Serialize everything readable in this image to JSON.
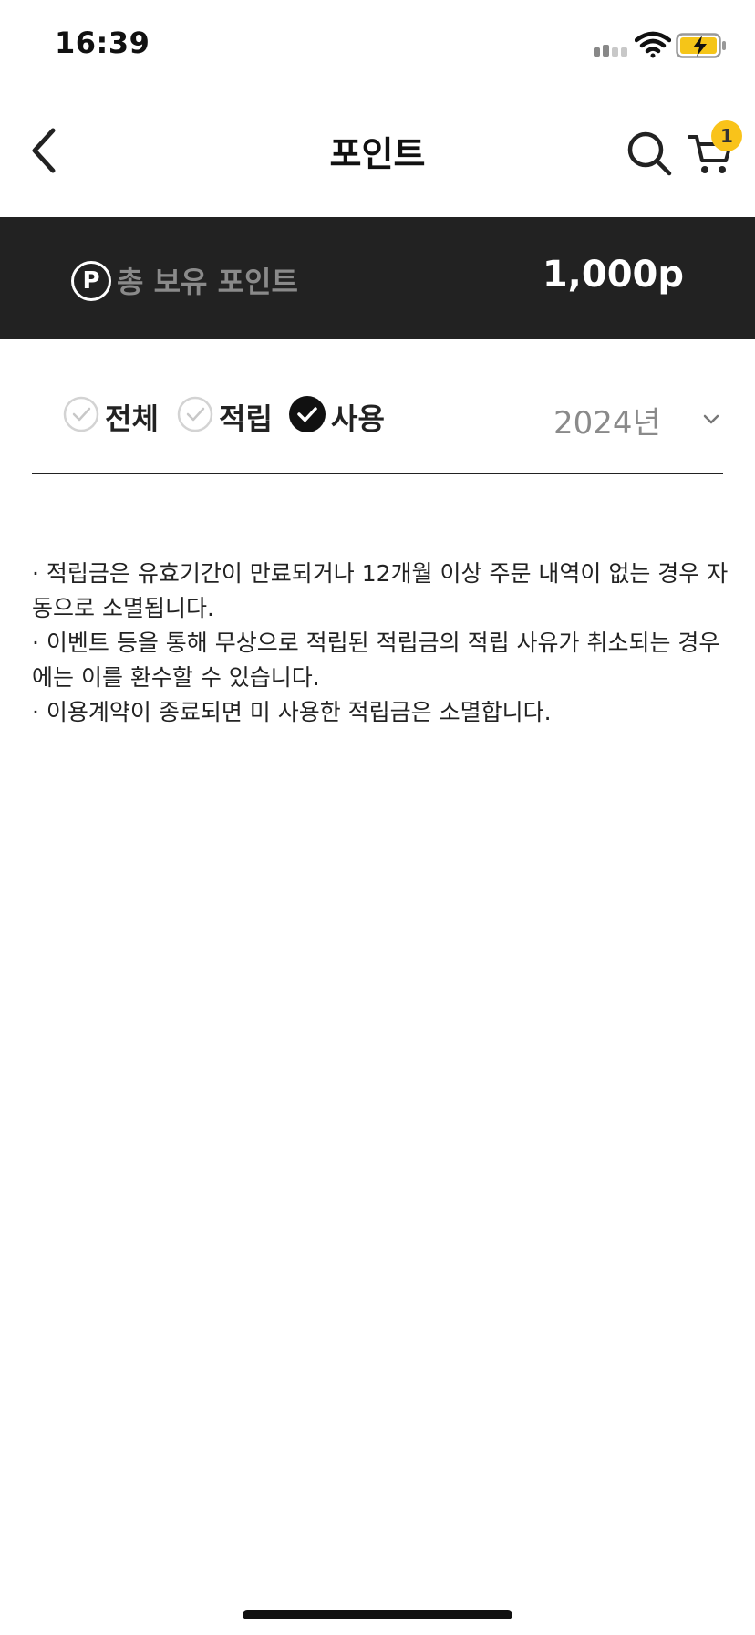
{
  "status_bar": {
    "time": "16:39"
  },
  "nav": {
    "title": "포인트",
    "cart_count": "1"
  },
  "points": {
    "icon_letter": "P",
    "label": "총 보유 포인트",
    "value": "1,000p"
  },
  "filters": [
    {
      "label": "전체",
      "checked": false
    },
    {
      "label": "적립",
      "checked": false
    },
    {
      "label": "사용",
      "checked": true
    }
  ],
  "year": {
    "selected": "2024년"
  },
  "notice": {
    "lines": [
      "· 적립금은 유효기간이 만료되거나 12개월 이상 주문 내역이 없는 경우 자",
      "동으로 소멸됩니다.",
      "· 이벤트 등을 통해 무상으로 적립된 적립금의 적립 사유가 취소되는 경우",
      "에는 이를 환수할 수 있습니다.",
      "· 이용계약이 종료되면 미 사용한 적립금은 소멸합니다."
    ]
  },
  "icons": {
    "back": "chevron-left-icon",
    "search": "search-icon",
    "cart": "cart-icon",
    "unchecked": "check-circle-outline-icon",
    "checked": "check-circle-filled-icon",
    "year_chevron": "chevron-down-icon"
  },
  "colors": {
    "banner_bg": "#222222",
    "badge": "#f9c31a",
    "battery_charge": "#f5c518",
    "muted_text": "#8a8a8a"
  }
}
